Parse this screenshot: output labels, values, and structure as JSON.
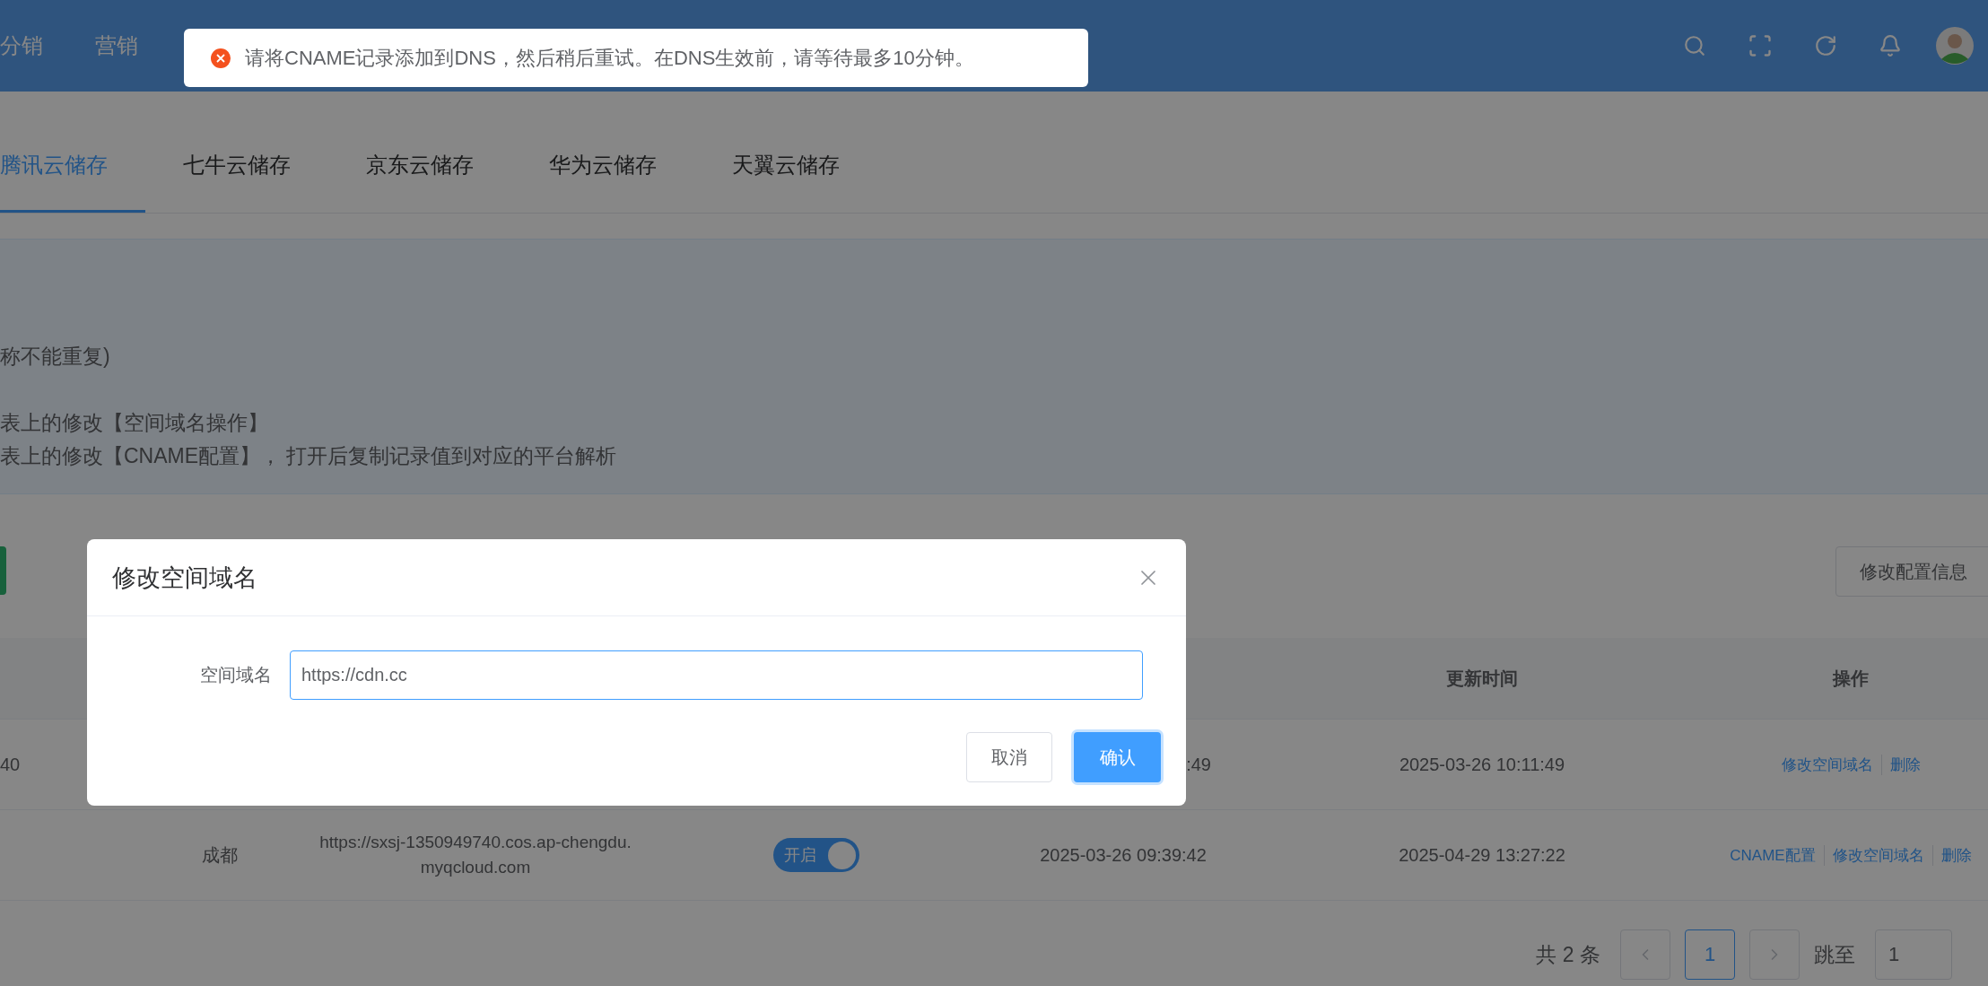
{
  "header": {
    "nav": [
      {
        "label": "分销"
      },
      {
        "label": "营销"
      }
    ]
  },
  "toast": {
    "kind": "error",
    "message": "请将CNAME记录添加到DNS，然后稍后重试。在DNS生效前，请等待最多10分钟。"
  },
  "tabs": [
    {
      "label": "腾讯云储存",
      "selected": true
    },
    {
      "label": "七牛云储存",
      "selected": false
    },
    {
      "label": "京东云储存",
      "selected": false
    },
    {
      "label": "华为云储存",
      "selected": false
    },
    {
      "label": "天翼云储存",
      "selected": false
    }
  ],
  "info": {
    "lines": [
      "称不能重复)",
      "表上的修改【空间域名操作】",
      "表上的修改【CNAME配置】， 打开后复制记录值到对应的平台解析"
    ]
  },
  "toolbar": {
    "edit_config_button": "修改配置信息"
  },
  "table": {
    "columns": [
      "",
      "",
      "",
      "",
      "",
      "更新时间",
      "操作"
    ],
    "rows": [
      {
        "cells": [
          "40",
          "",
          "",
          "",
          ":49",
          "2025-03-26 10:11:49"
        ],
        "partly_covered": true,
        "actions": [
          "修改空间域名",
          "删除"
        ]
      },
      {
        "cells": [
          "",
          "成都",
          "https://sxsj-1350949740.cos.ap-chengdu.myqcloud.com",
          "",
          "2025-03-26 09:39:42",
          "2025-04-29 13:27:22"
        ],
        "toggle": {
          "label": "开启",
          "on": true
        },
        "actions": [
          "CNAME配置",
          "修改空间域名",
          "删除"
        ]
      }
    ]
  },
  "pagination": {
    "total": "共 2 条",
    "pages": [
      {
        "label": "1",
        "selected": true
      }
    ],
    "jump_label": "跳至",
    "jump_value": "1"
  },
  "dialog": {
    "title": "修改空间域名",
    "field_label": "空间域名",
    "field_value": "https://cdn.cc",
    "cancel": "取消",
    "confirm": "确认"
  }
}
